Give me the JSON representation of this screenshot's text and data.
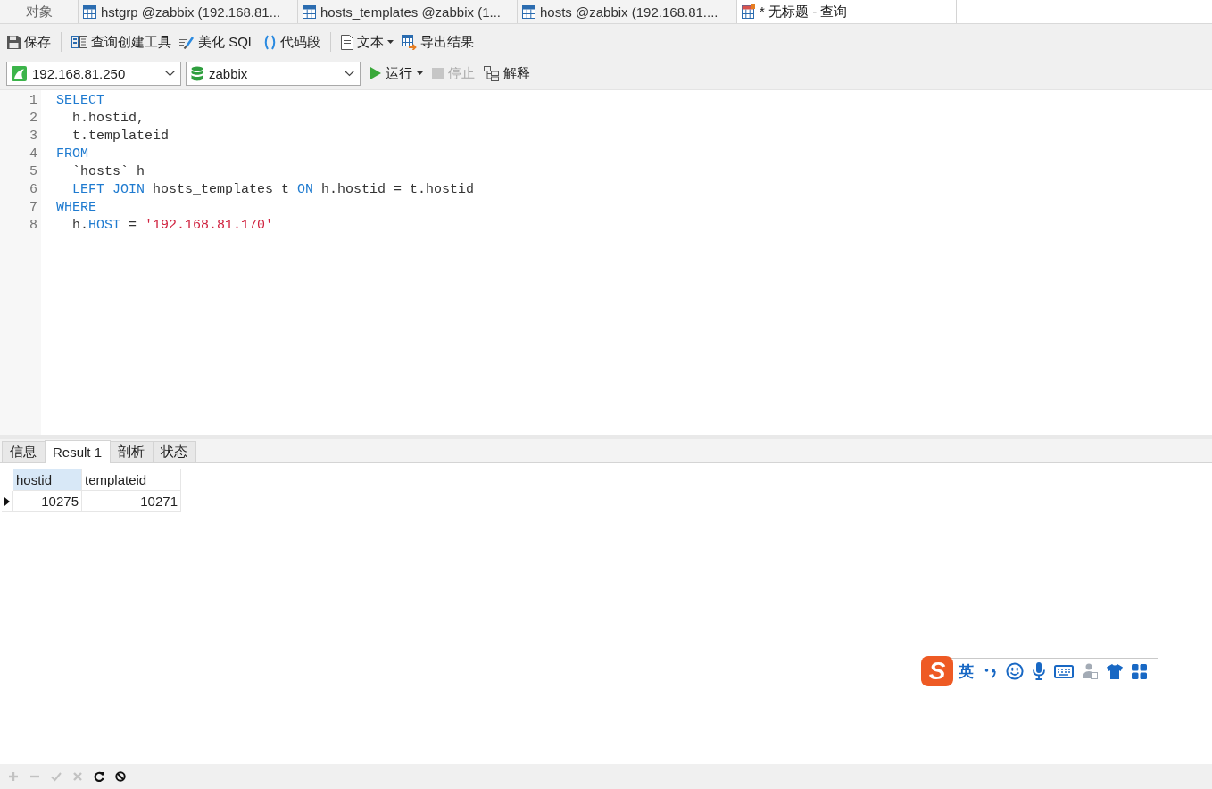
{
  "object_tab": {
    "label": "对象"
  },
  "tabs": [
    {
      "kind": "table",
      "label": "hstgrp @zabbix (192.168.81...",
      "selected": false
    },
    {
      "kind": "table",
      "label": "hosts_templates @zabbix (1...",
      "selected": false
    },
    {
      "kind": "table",
      "label": "hosts @zabbix (192.168.81....",
      "selected": false
    },
    {
      "kind": "query",
      "label": "* 无标题 - 查询",
      "selected": true
    }
  ],
  "toolbar": {
    "groups": [
      [
        {
          "kind": "save",
          "label": "保存",
          "dropdown": false
        }
      ],
      [
        {
          "kind": "query_builder",
          "label": "查询创建工具",
          "dropdown": false
        },
        {
          "kind": "beautify",
          "label": "美化 SQL",
          "dropdown": false
        },
        {
          "kind": "snippet",
          "label": "代码段",
          "dropdown": false
        }
      ],
      [
        {
          "kind": "text",
          "label": "文本",
          "dropdown": true
        },
        {
          "kind": "export",
          "label": "导出结果",
          "dropdown": false
        }
      ]
    ]
  },
  "connection": {
    "value": "192.168.81.250"
  },
  "database": {
    "value": "zabbix"
  },
  "run_controls": [
    {
      "kind": "run",
      "label": "运行",
      "dropdown": true,
      "disabled": false
    },
    {
      "kind": "stop",
      "label": "停止",
      "dropdown": false,
      "disabled": true
    },
    {
      "kind": "explain",
      "label": "解释",
      "dropdown": false,
      "disabled": false
    }
  ],
  "editor": {
    "lines": [
      {
        "number": "1",
        "tokens": [
          {
            "kind": "keyword",
            "text": "SELECT"
          }
        ],
        "children": [
          {
            "number": "2",
            "tokens": [
              {
                "kind": "plain",
                "text": "h.hostid,"
              }
            ]
          },
          {
            "number": "3",
            "tokens": [
              {
                "kind": "plain",
                "text": "t.templateid"
              }
            ]
          }
        ]
      },
      {
        "number": "4",
        "tokens": [
          {
            "kind": "keyword",
            "text": "FROM"
          }
        ],
        "children": [
          {
            "number": "5",
            "tokens": [
              {
                "kind": "plain",
                "text": "`hosts` h"
              }
            ]
          },
          {
            "number": "6",
            "tokens": [
              {
                "kind": "keyword",
                "text": "LEFT JOIN"
              },
              {
                "kind": "plain",
                "text": " hosts_templates t "
              },
              {
                "kind": "keyword",
                "text": "ON"
              },
              {
                "kind": "plain",
                "text": " h.hostid = t.hostid"
              }
            ]
          }
        ]
      },
      {
        "number": "7",
        "tokens": [
          {
            "kind": "keyword",
            "text": "WHERE"
          }
        ],
        "children": [
          {
            "number": "8",
            "tokens": [
              {
                "kind": "plain",
                "text": "h."
              },
              {
                "kind": "keyword",
                "text": "HOST"
              },
              {
                "kind": "plain",
                "text": " = "
              },
              {
                "kind": "string",
                "text": "'192.168.81.170'"
              }
            ]
          }
        ]
      }
    ]
  },
  "result_tabs": [
    {
      "label": "信息",
      "selected": false
    },
    {
      "label": "Result 1",
      "selected": true
    },
    {
      "label": "剖析",
      "selected": false
    },
    {
      "label": "状态",
      "selected": false
    }
  ],
  "result_grid": {
    "columns": [
      {
        "label": "hostid",
        "selected": true
      },
      {
        "label": "templateid",
        "selected": false
      }
    ],
    "rows": [
      {
        "current": true,
        "cells": [
          "10275",
          "10271"
        ]
      }
    ]
  },
  "status_bar": {
    "buttons": [
      {
        "kind": "add",
        "disabled": true
      },
      {
        "kind": "remove",
        "disabled": true
      },
      {
        "kind": "apply",
        "disabled": true
      },
      {
        "kind": "discard",
        "disabled": true
      },
      {
        "kind": "refresh",
        "disabled": false
      },
      {
        "kind": "stop",
        "disabled": false
      }
    ]
  },
  "ime_bar": {
    "logo": "S",
    "mode": "英",
    "tools": [
      {
        "kind": "punctuation"
      },
      {
        "kind": "emoji"
      },
      {
        "kind": "voice"
      },
      {
        "kind": "keyboard"
      },
      {
        "kind": "account"
      },
      {
        "kind": "skin"
      },
      {
        "kind": "toolbox"
      }
    ]
  }
}
